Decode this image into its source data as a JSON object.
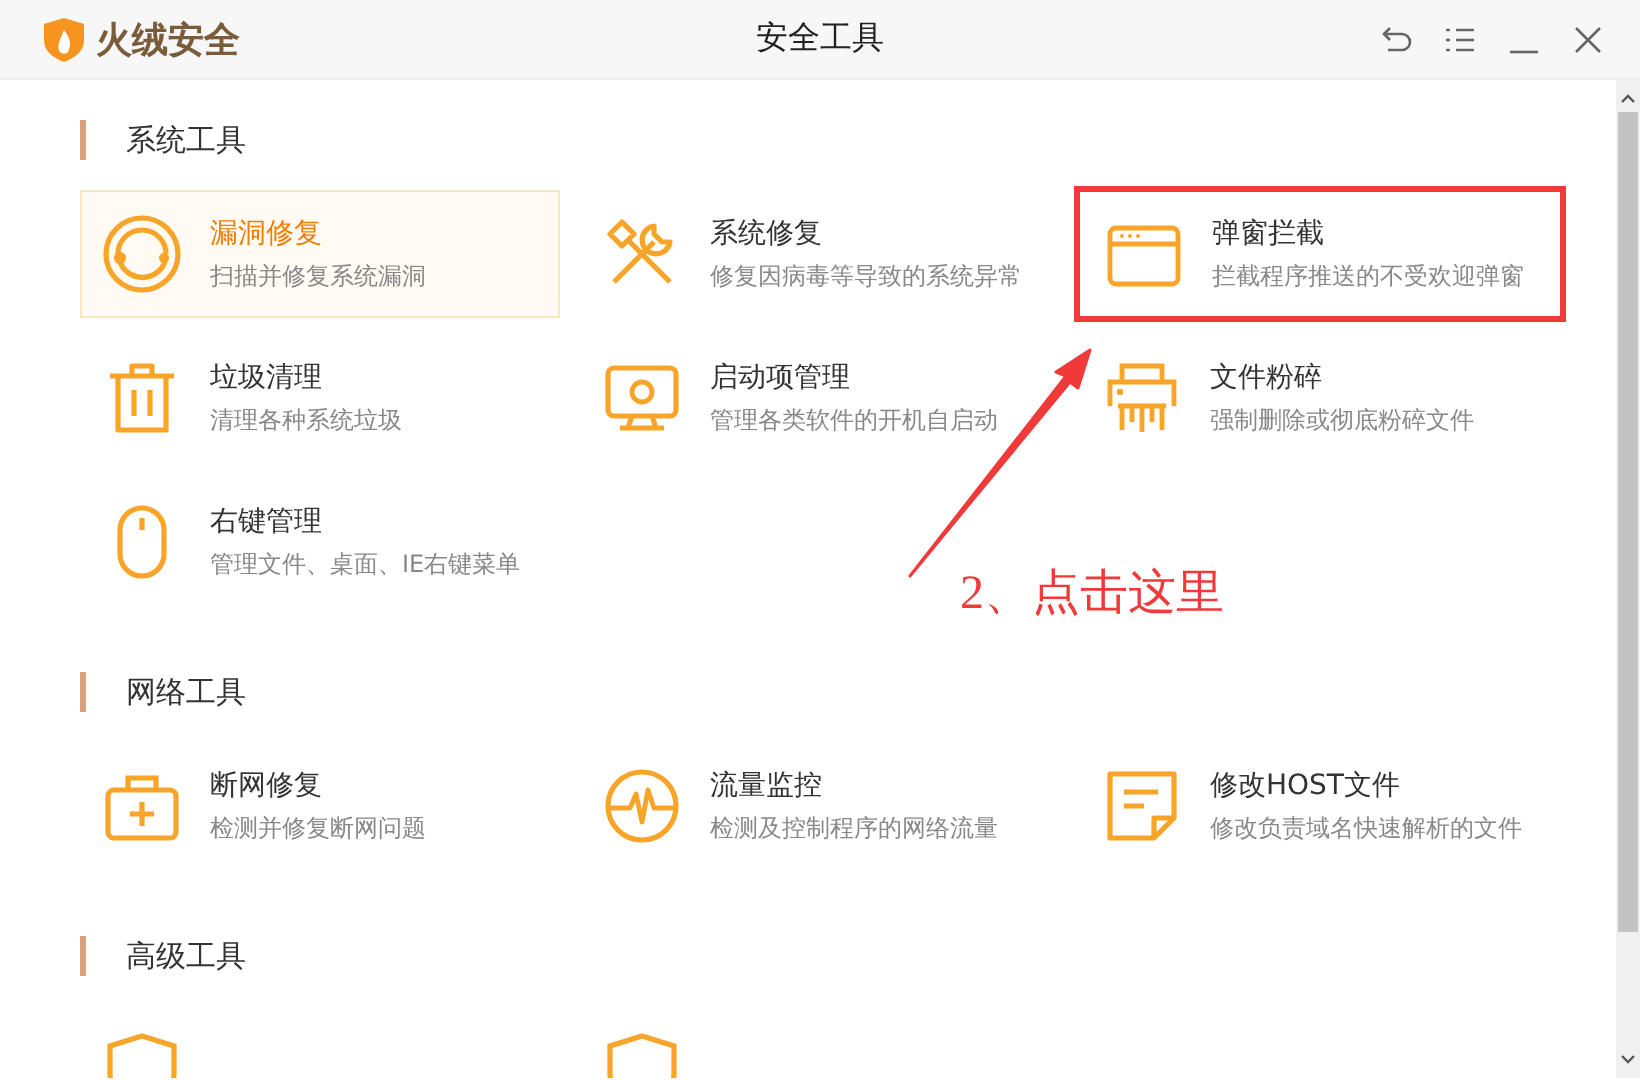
{
  "window": {
    "brand": "火绒安全",
    "title": "安全工具"
  },
  "sections": [
    {
      "title": "系统工具",
      "items": [
        {
          "title": "漏洞修复",
          "desc": "扫描并修复系统漏洞",
          "selected": true,
          "annotated": false
        },
        {
          "title": "系统修复",
          "desc": "修复因病毒等导致的系统异常",
          "selected": false,
          "annotated": false
        },
        {
          "title": "弹窗拦截",
          "desc": "拦截程序推送的不受欢迎弹窗",
          "selected": false,
          "annotated": true
        },
        {
          "title": "垃圾清理",
          "desc": "清理各种系统垃圾",
          "selected": false,
          "annotated": false
        },
        {
          "title": "启动项管理",
          "desc": "管理各类软件的开机自启动",
          "selected": false,
          "annotated": false
        },
        {
          "title": "文件粉碎",
          "desc": "强制删除或彻底粉碎文件",
          "selected": false,
          "annotated": false
        },
        {
          "title": "右键管理",
          "desc": "管理文件、桌面、IE右键菜单",
          "selected": false,
          "annotated": false
        }
      ]
    },
    {
      "title": "网络工具",
      "items": [
        {
          "title": "断网修复",
          "desc": "检测并修复断网问题",
          "selected": false,
          "annotated": false
        },
        {
          "title": "流量监控",
          "desc": "检测及控制程序的网络流量",
          "selected": false,
          "annotated": false
        },
        {
          "title": "修改HOST文件",
          "desc": "修改负责域名快速解析的文件",
          "selected": false,
          "annotated": false
        }
      ]
    },
    {
      "title": "高级工具",
      "items": [
        {
          "selected": false,
          "annotated": false
        },
        {
          "selected": false,
          "annotated": false
        }
      ]
    }
  ],
  "annotation": {
    "text": "2、点击这里"
  }
}
